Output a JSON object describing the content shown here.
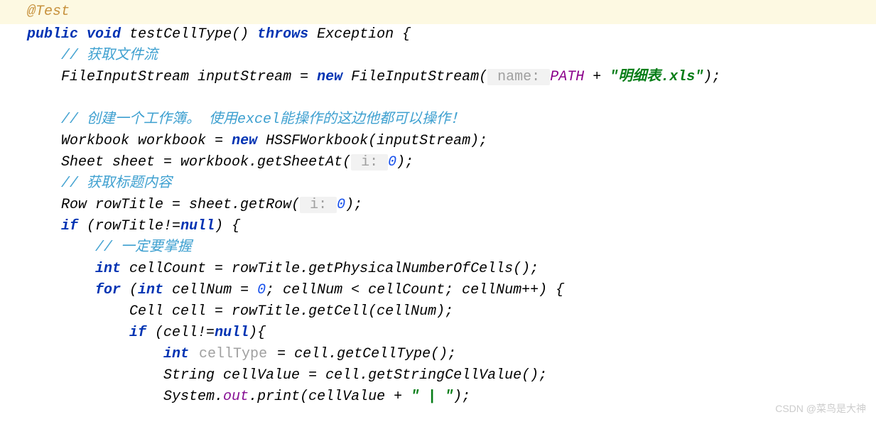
{
  "annotation": "@Test",
  "line_method": {
    "public": "public",
    "void": "void",
    "name": "testCellType()",
    "throws": "throws",
    "exception": "Exception {"
  },
  "c_getfile": "// 获取文件流",
  "fis": {
    "type": "FileInputStream",
    "var": "inputStream",
    "eq": " = ",
    "new": "new",
    "ctor": "FileInputStream(",
    "hint": " name: ",
    "const": "PATH",
    "plus": " + ",
    "str": "\"明细表.xls\"",
    "end": ");"
  },
  "c_workbook": "// 创建一个工作簿。 使用excel能操作的这边他都可以操作！",
  "wb": {
    "type": "Workbook",
    "var": "workbook",
    "eq": " = ",
    "new": "new",
    "ctor": " HSSFWorkbook(inputStream);"
  },
  "sheet": {
    "type": "Sheet sheet = workbook.getSheetAt(",
    "hint": " i: ",
    "num": "0",
    "end": ");"
  },
  "c_title": "// 获取标题内容",
  "row": {
    "decl": "Row rowTitle = sheet.getRow(",
    "hint": " i: ",
    "num": "0",
    "end": ");"
  },
  "if_row": {
    "if": "if",
    "cond_open": " (rowTitle!=",
    "null": "null",
    "cond_close": ") {"
  },
  "c_must": "// 一定要掌握",
  "cellcount": {
    "int": "int",
    "rest": " cellCount = rowTitle.getPhysicalNumberOfCells();"
  },
  "for": {
    "for": "for",
    "open": " (",
    "int": "int",
    "init": " cellNum = ",
    "zero": "0",
    "cond": "; cellNum < cellCount; cellNum++) {"
  },
  "cell_decl": "Cell cell = rowTitle.getCell(cellNum);",
  "if_cell": {
    "if": "if",
    "open": " (cell!=",
    "null": "null",
    "close": "){"
  },
  "celltype": {
    "int": "int",
    "var": " cellType",
    "rest": " = cell.getCellType();"
  },
  "cellvalue": "String cellValue = cell.getStringCellValue();",
  "print": {
    "sys": "System.",
    "out": "out",
    "method": ".print(cellValue + ",
    "str": "\" | \"",
    "end": ");"
  },
  "watermark": "CSDN @菜鸟是大神"
}
